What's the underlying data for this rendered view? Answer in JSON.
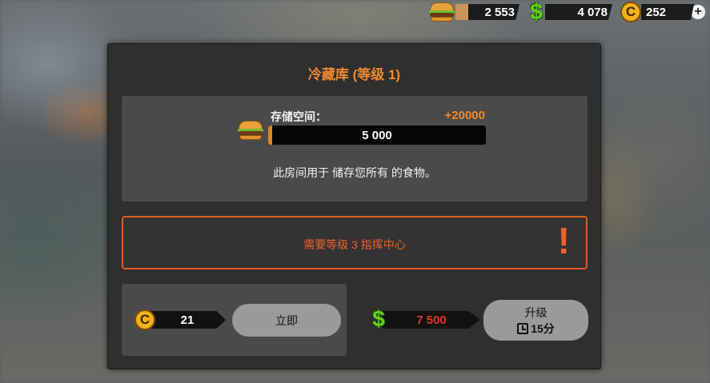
{
  "resources": {
    "food": {
      "icon": "burger-icon",
      "value": "2 553"
    },
    "cash": {
      "icon": "dollar-icon",
      "value": "4 078"
    },
    "gold": {
      "icon": "gold-coin-icon",
      "coin_letter": "C",
      "value": "252",
      "add_label": "+"
    }
  },
  "dialog": {
    "title": "冷藏库 (等级 1)",
    "storage": {
      "icon": "burger-icon",
      "label": "存储空间：",
      "bonus": "+20000",
      "value": "5 000",
      "fill_fraction": 0.02
    },
    "description": "此房间用于 储存您所有 的食物。",
    "requirement": {
      "text": "需要等级 3 指挥中心",
      "alert": "!"
    },
    "instant": {
      "icon": "gold-coin-icon",
      "coin_letter": "C",
      "cost": "21",
      "button_label": "立即"
    },
    "upgrade": {
      "icon": "dollar-icon",
      "dollar_symbol": "$",
      "cost": "7 500",
      "button_label": "升级",
      "time": "15分"
    }
  },
  "colors": {
    "accent_orange": "#f08a2c",
    "warning_red": "#f0602a",
    "cost_red": "#e23b1c",
    "cash_green": "#5fd41c",
    "gold": "#f3b21d"
  }
}
